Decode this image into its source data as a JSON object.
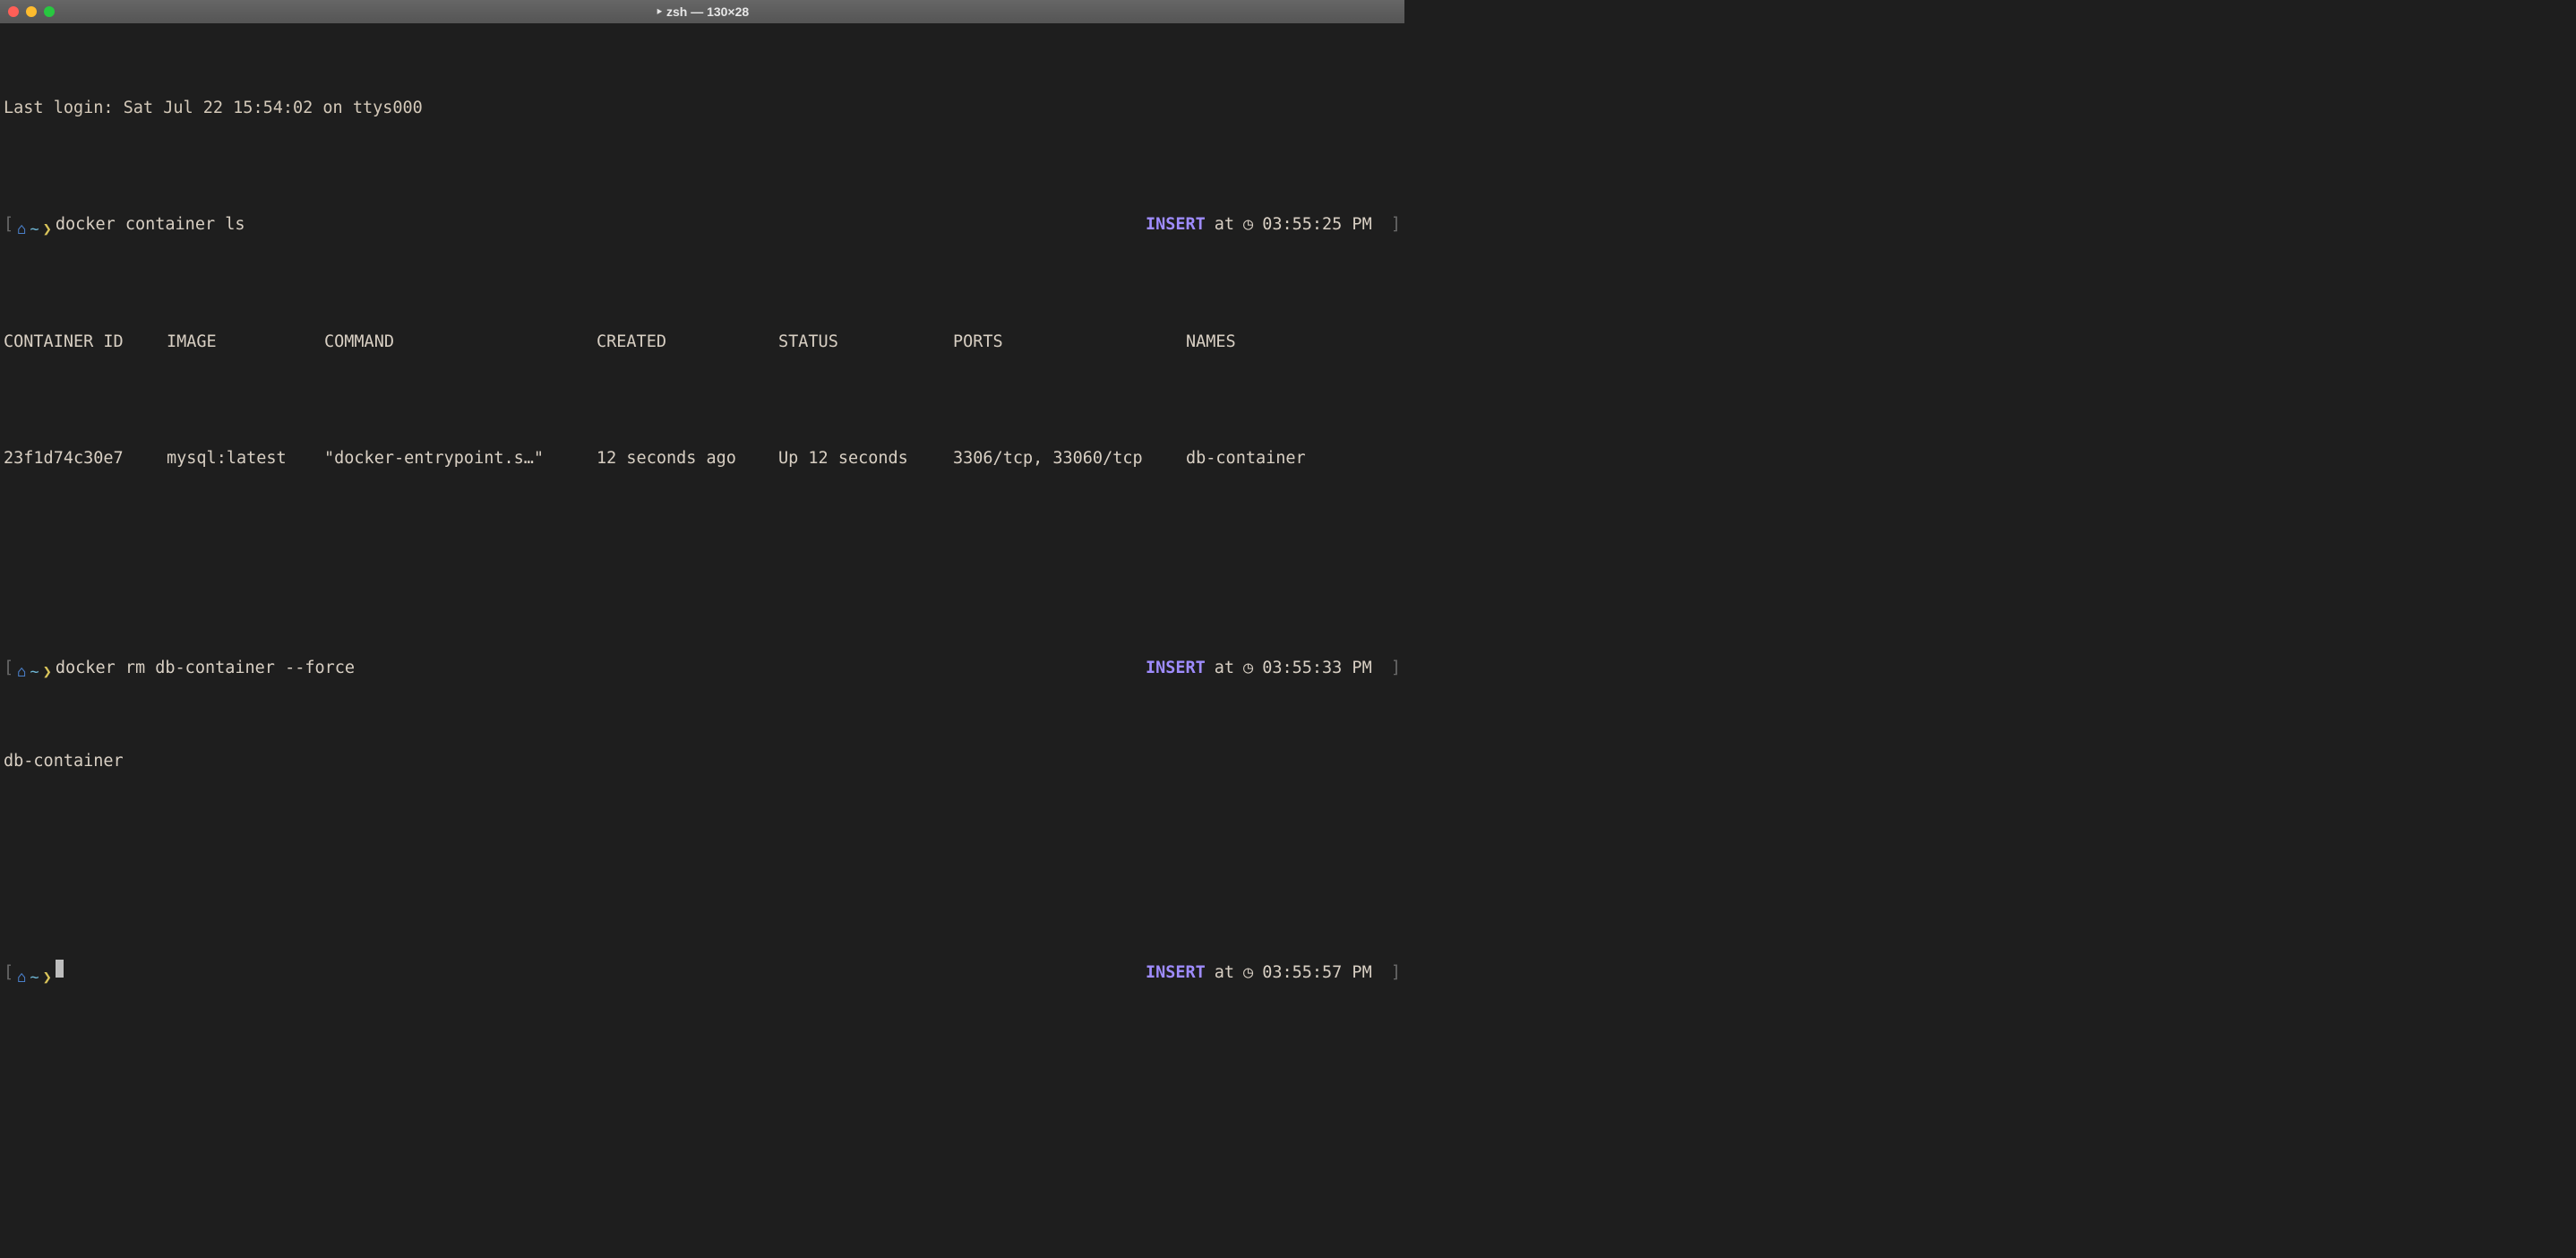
{
  "window": {
    "title": "‣ zsh — 130×28"
  },
  "lastlogin": "Last login: Sat Jul 22 15:54:02 on ttys000",
  "prompts": [
    {
      "command": "docker container ls",
      "insert": "INSERT",
      "at": "at",
      "time": "03:55:25 PM"
    },
    {
      "command": "docker rm db-container --force",
      "insert": "INSERT",
      "at": "at",
      "time": "03:55:33 PM"
    },
    {
      "command": "",
      "insert": "INSERT",
      "at": "at",
      "time": "03:55:57 PM"
    }
  ],
  "table": {
    "headers": {
      "id": "CONTAINER ID",
      "image": "IMAGE",
      "command": "COMMAND",
      "created": "CREATED",
      "status": "STATUS",
      "ports": "PORTS",
      "names": "NAMES"
    },
    "rows": [
      {
        "id": "23f1d74c30e7",
        "image": "mysql:latest",
        "command": "\"docker-entrypoint.s…\"",
        "created": "12 seconds ago",
        "status": "Up 12 seconds",
        "ports": "3306/tcp, 33060/tcp",
        "names": "db-container"
      }
    ]
  },
  "rm_output": "db-container",
  "icons": {
    "apple": "",
    "home": "⌂",
    "tilde": "~",
    "angle": "❯",
    "clock": "◷"
  }
}
